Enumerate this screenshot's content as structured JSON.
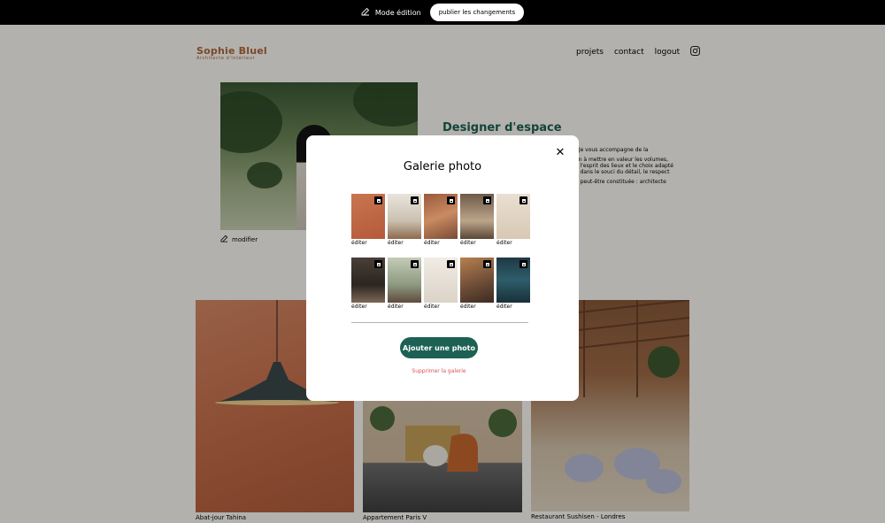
{
  "edit_bar": {
    "mode_label": "Mode édition",
    "publish_label": "publier les changements"
  },
  "header": {
    "logo_name": "Sophie Bluel",
    "logo_subtitle": "Architecte d'intérieur",
    "nav": [
      "projets",
      "contact",
      "logout"
    ],
    "instagram_icon": "instagram-icon"
  },
  "intro": {
    "modifier_label": "modifier",
    "title": "Designer d'espace",
    "text_lines": [
      ". Je vous accompagne de la",
      "on à mettre en valeur les volumes,",
      "e l'esprit des lieux et le choix adapté",
      "é dans le souci du détail, le respect",
      "e peut-être constituée : architecte"
    ]
  },
  "gallery": [
    {
      "caption": "Abat-jour Tahina"
    },
    {
      "caption": "Appartement Paris V"
    },
    {
      "caption": "Restaurant Sushisen - Londres"
    }
  ],
  "modal": {
    "title": "Galerie photo",
    "close_glyph": "✕",
    "edit_label": "éditer",
    "thumb_count": 10,
    "add_label": "Ajouter une photo",
    "delete_label": "Supprimer la galerie"
  },
  "colors": {
    "brand": "#B1663C",
    "accent": "#1D6154",
    "danger": "#D65353"
  }
}
